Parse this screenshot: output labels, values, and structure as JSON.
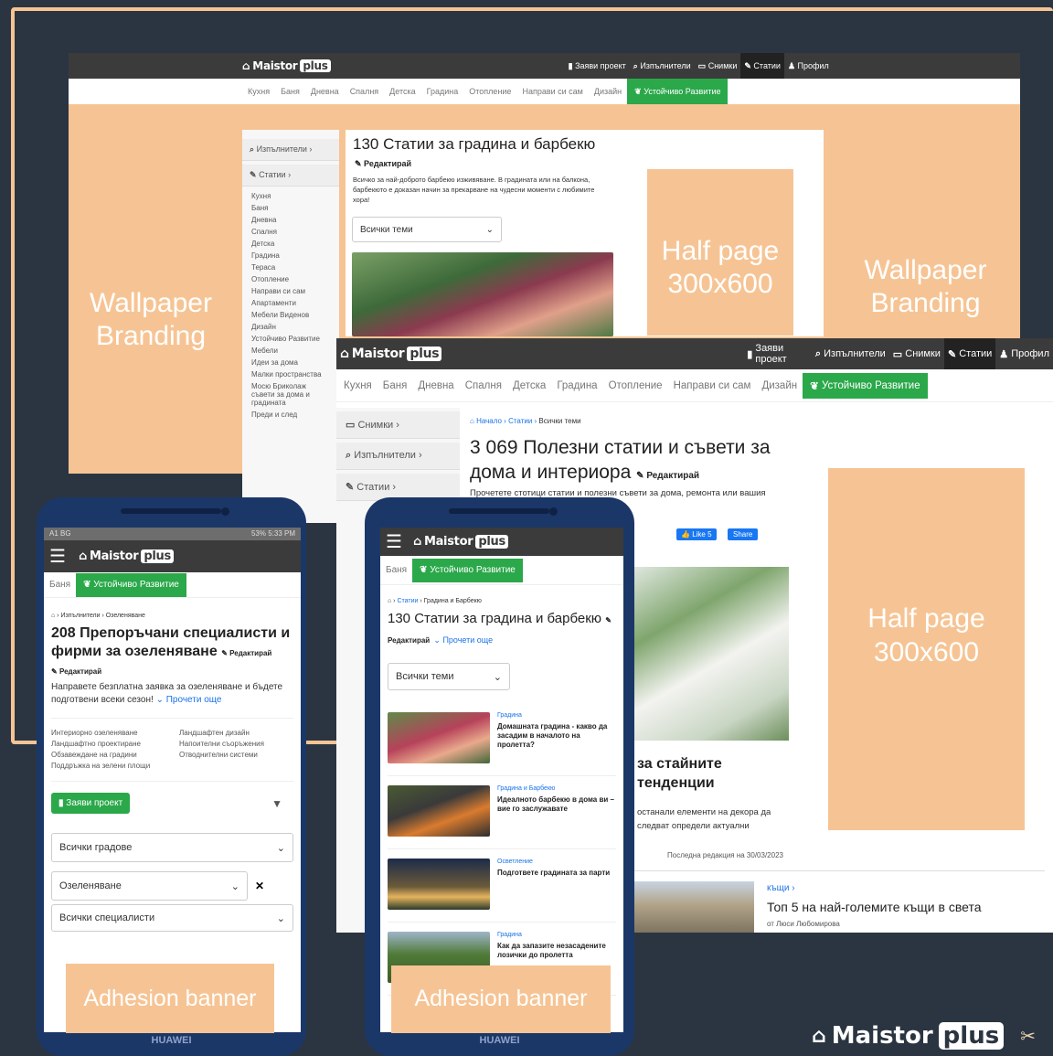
{
  "colors": {
    "background": "#2b3541",
    "ad": "#f6c494",
    "green": "#2aa84a",
    "topbar": "#3b3b3b",
    "link": "#1a73e8"
  },
  "brand": {
    "logo_word": "Maistor",
    "logo_plus": "plus"
  },
  "nav": {
    "items": [
      "Заяви проект",
      "Изпълнители",
      "Снимки",
      "Статии",
      "Профил"
    ]
  },
  "categories": [
    "Кухня",
    "Баня",
    "Дневна",
    "Спалня",
    "Детска",
    "Градина",
    "Отопление",
    "Направи си сам",
    "Дизайн"
  ],
  "green_category": "Устойчиво Развитие",
  "ads": {
    "wallpaper": "Wallpaper Branding",
    "halfpage": "Half page 300x600",
    "adhesion": "Adhesion banner"
  },
  "desktop1": {
    "side_performers": "Изпълнители",
    "side_articles": "Статии",
    "side_list": [
      "Кухня",
      "Баня",
      "Дневна",
      "Спалня",
      "Детска",
      "Градина",
      "Тераса",
      "Отопление",
      "Направи си сам",
      "Апартаменти",
      "Мебели Виденов",
      "Дизайн",
      "Устойчиво Развитие",
      "Мебели",
      "Идеи за дома",
      "Малки пространства",
      "Мосю Бриколаж съвети за дома и градината",
      "Преди и след"
    ],
    "title": "130 Статии за градина и барбекю",
    "edit": "Редактирай",
    "desc": "Всичко за най-доброто барбекю изживяване. В градината или на балкона, барбекюто е доказан начин за прекарване на чудесни моменти с любимите хора!",
    "select": "Всички теми"
  },
  "desktop2": {
    "side_photos": "Снимки",
    "side_performers": "Изпълнители",
    "side_articles": "Статии",
    "breadcrumb": [
      "Начало",
      "Статии",
      "Всички теми"
    ],
    "title": "3 069 Полезни статии и съвети за дома и интериора",
    "edit": "Редактирай",
    "desc": "Прочетете стотици статии и полезни съвети за дома, ремонта или вашия",
    "like": "Like 5",
    "share": "Share",
    "partial_title": "за стайните тенденции",
    "partial_desc": "останали елементи на декора да следват определи актуални",
    "updated": "Последна редакция на 30/03/2023",
    "card_cat": "къщи",
    "card_title": "Топ 5 на най-големите къщи в света",
    "card_author": "от Люси Любомирова"
  },
  "phone1": {
    "status_left": "A1 BG",
    "status_right": "53% 5:33 PM",
    "tab_bath": "Баня",
    "breadcrumb": "Изпълнители › Озеленяване",
    "title": "208 Препоръчани специалисти и фирми за озеленяване",
    "edit": "Редактирай",
    "edit2": "Редактирай",
    "desc": "Направете безплатна заявка за озеленяване и бъдете подготвени всеки сезон!",
    "more": "Прочети още",
    "links_left": [
      "Интериорно озеленяване",
      "Ландшафтно проектиране",
      "Обзавеждане на градини",
      "Поддръжка на зелени площи"
    ],
    "links_right": [
      "Ландшафтен дизайн",
      "Напоителни съоръжения",
      "Отводнителни системи"
    ],
    "request": "Заяви проект",
    "city_select": "Всички градове",
    "service_select": "Озеленяване",
    "third_select": "Всички специалисти",
    "brand": "HUAWEI"
  },
  "phone2": {
    "tab_bath": "Баня",
    "breadcrumb": [
      "Статии",
      "Градина и Барбекю"
    ],
    "title": "130 Статии за градина и барбекю",
    "edit": "Редактирай",
    "more": "Прочети още",
    "select": "Всички теми",
    "cards": [
      {
        "cat": "Градина",
        "title": "Домашната градина - какво да засадим в началото на пролетта?"
      },
      {
        "cat": "Градина и Барбекю",
        "title": "Идеалното барбекю в дома ви – вие го заслужавате"
      },
      {
        "cat": "Осветление",
        "title": "Подгответе градината за парти"
      },
      {
        "cat": "Градина",
        "title": "Как да запазите незасадените лозички до пролетта"
      }
    ],
    "brand": "HUAWEI"
  }
}
